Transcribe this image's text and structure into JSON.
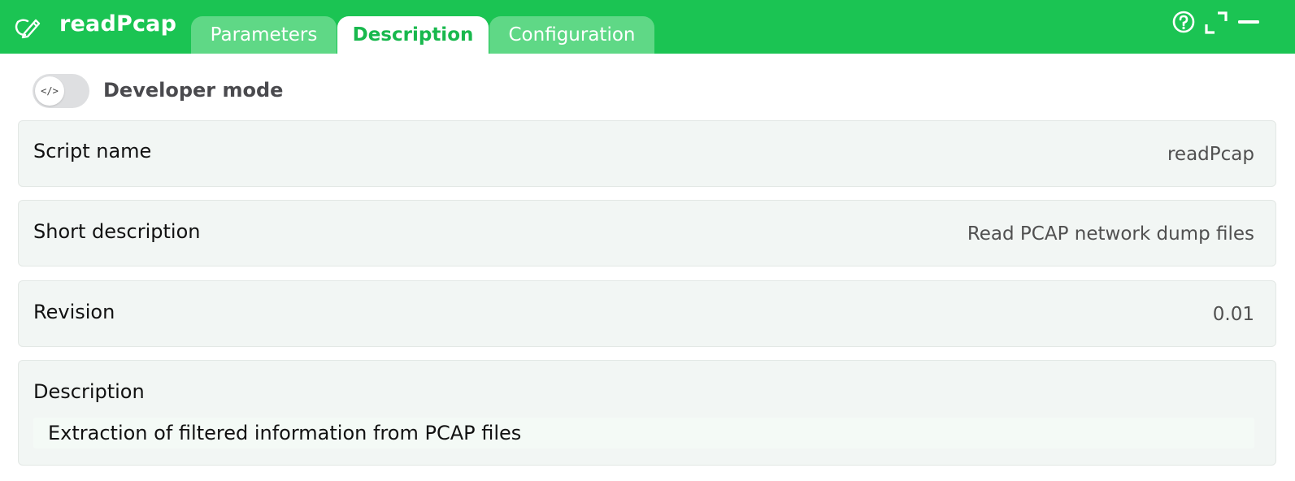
{
  "header": {
    "app_title": "readPcap",
    "app_icon": "script-edit-icon",
    "tabs": [
      {
        "label": "Parameters",
        "active": false
      },
      {
        "label": "Description",
        "active": true
      },
      {
        "label": "Configuration",
        "active": false
      }
    ],
    "window_buttons": [
      "help-icon",
      "expand-icon",
      "minimize-icon"
    ]
  },
  "developer_mode": {
    "label": "Developer mode",
    "toggle_icon": "</>",
    "enabled": false
  },
  "fields": [
    {
      "label": "Script name",
      "value": "readPcap"
    },
    {
      "label": "Short description",
      "value": "Read PCAP network dump files"
    },
    {
      "label": "Revision",
      "value": "0.01"
    }
  ],
  "description": {
    "label": "Description",
    "text": "Extraction of filtered information from PCAP files"
  },
  "colors": {
    "accent": "#1bc453",
    "tab_inactive": "#5fd886",
    "tab_active_text": "#18b84d",
    "row_background": "#f2f6f4"
  }
}
